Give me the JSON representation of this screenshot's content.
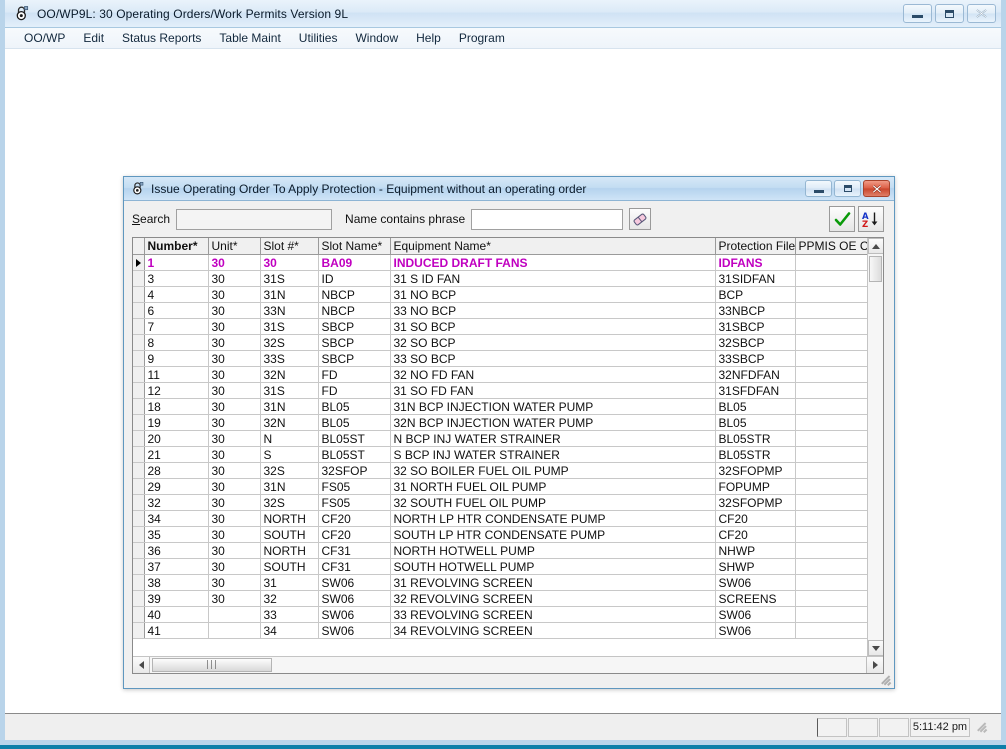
{
  "app": {
    "title": "OO/WP9L: 30  Operating Orders/Work Permits Version 9L",
    "icon": "padlock-icon",
    "window_buttons": {
      "minimize": "minimize-icon",
      "maximize": "maximize-icon",
      "close": "close-icon"
    }
  },
  "menubar": {
    "items": [
      {
        "label": "OO/WP"
      },
      {
        "label": "Edit"
      },
      {
        "label": "Status Reports"
      },
      {
        "label": "Table Maint"
      },
      {
        "label": "Utilities"
      },
      {
        "label": "Window"
      },
      {
        "label": "Help"
      },
      {
        "label": "Program"
      }
    ]
  },
  "child_window": {
    "title": "Issue Operating Order To Apply Protection - Equipment without an operating order",
    "icon": "padlock-icon",
    "window_buttons": {
      "minimize": "minimize-icon",
      "restore": "restore-icon",
      "close": "close-icon"
    },
    "toolbar": {
      "search_label": "Search",
      "search_label_mnemonic": "S",
      "search_value": "",
      "search_placeholder": "",
      "phrase_label": "Name contains phrase",
      "phrase_value": "",
      "phrase_placeholder": "",
      "eraser_button": "eraser-icon",
      "accept_button": "green-check-icon",
      "sort_button": "sort-az-icon"
    }
  },
  "grid": {
    "columns": [
      {
        "key": "number",
        "label": "Number*"
      },
      {
        "key": "unit",
        "label": "Unit*"
      },
      {
        "key": "slot_num",
        "label": "Slot #*"
      },
      {
        "key": "slot_name",
        "label": "Slot Name*"
      },
      {
        "key": "equipment_name",
        "label": "Equipment Name*"
      },
      {
        "key": "protection_file",
        "label": "Protection File*"
      },
      {
        "key": "ppmis_oe_code",
        "label": "PPMIS OE Code*"
      }
    ],
    "selected_row_index": 0,
    "rows": [
      {
        "number": "1",
        "unit": "30",
        "slot_num": "30",
        "slot_name": "BA09",
        "equipment_name": "INDUCED DRAFT FANS",
        "protection_file": "IDFANS",
        "ppmis_oe_code": ""
      },
      {
        "number": "3",
        "unit": "30",
        "slot_num": "31S",
        "slot_name": "ID",
        "equipment_name": "31 S ID FAN",
        "protection_file": "31SIDFAN",
        "ppmis_oe_code": ""
      },
      {
        "number": "4",
        "unit": "30",
        "slot_num": "31N",
        "slot_name": "NBCP",
        "equipment_name": "31 NO BCP",
        "protection_file": "BCP",
        "ppmis_oe_code": ""
      },
      {
        "number": "6",
        "unit": "30",
        "slot_num": "33N",
        "slot_name": "NBCP",
        "equipment_name": "33 NO BCP",
        "protection_file": "33NBCP",
        "ppmis_oe_code": ""
      },
      {
        "number": "7",
        "unit": "30",
        "slot_num": "31S",
        "slot_name": "SBCP",
        "equipment_name": "31 SO BCP",
        "protection_file": "31SBCP",
        "ppmis_oe_code": ""
      },
      {
        "number": "8",
        "unit": "30",
        "slot_num": "32S",
        "slot_name": "SBCP",
        "equipment_name": "32 SO BCP",
        "protection_file": "32SBCP",
        "ppmis_oe_code": ""
      },
      {
        "number": "9",
        "unit": "30",
        "slot_num": "33S",
        "slot_name": "SBCP",
        "equipment_name": "33 SO BCP",
        "protection_file": "33SBCP",
        "ppmis_oe_code": ""
      },
      {
        "number": "11",
        "unit": "30",
        "slot_num": "32N",
        "slot_name": "FD",
        "equipment_name": "32 NO FD FAN",
        "protection_file": "32NFDFAN",
        "ppmis_oe_code": ""
      },
      {
        "number": "12",
        "unit": "30",
        "slot_num": "31S",
        "slot_name": "FD",
        "equipment_name": "31 SO FD FAN",
        "protection_file": "31SFDFAN",
        "ppmis_oe_code": ""
      },
      {
        "number": "18",
        "unit": "30",
        "slot_num": "31N",
        "slot_name": "BL05",
        "equipment_name": "31N BCP INJECTION WATER PUMP",
        "protection_file": "BL05",
        "ppmis_oe_code": ""
      },
      {
        "number": "19",
        "unit": "30",
        "slot_num": "32N",
        "slot_name": "BL05",
        "equipment_name": "32N BCP INJECTION WATER PUMP",
        "protection_file": "BL05",
        "ppmis_oe_code": ""
      },
      {
        "number": "20",
        "unit": "30",
        "slot_num": "N",
        "slot_name": "BL05ST",
        "equipment_name": "N BCP INJ WATER STRAINER",
        "protection_file": "BL05STR",
        "ppmis_oe_code": ""
      },
      {
        "number": "21",
        "unit": "30",
        "slot_num": "S",
        "slot_name": "BL05ST",
        "equipment_name": "S BCP INJ WATER STRAINER",
        "protection_file": "BL05STR",
        "ppmis_oe_code": ""
      },
      {
        "number": "28",
        "unit": "30",
        "slot_num": "32S",
        "slot_name": "32SFOP",
        "equipment_name": "32 SO BOILER FUEL OIL PUMP",
        "protection_file": "32SFOPMP",
        "ppmis_oe_code": ""
      },
      {
        "number": "29",
        "unit": "30",
        "slot_num": "31N",
        "slot_name": "FS05",
        "equipment_name": "31 NORTH FUEL OIL PUMP",
        "protection_file": "FOPUMP",
        "ppmis_oe_code": ""
      },
      {
        "number": "32",
        "unit": "30",
        "slot_num": "32S",
        "slot_name": "FS05",
        "equipment_name": "32 SOUTH FUEL OIL PUMP",
        "protection_file": "32SFOPMP",
        "ppmis_oe_code": ""
      },
      {
        "number": "34",
        "unit": "30",
        "slot_num": "NORTH",
        "slot_name": "CF20",
        "equipment_name": "NORTH LP HTR CONDENSATE PUMP",
        "protection_file": "CF20",
        "ppmis_oe_code": ""
      },
      {
        "number": "35",
        "unit": "30",
        "slot_num": "SOUTH",
        "slot_name": "CF20",
        "equipment_name": "SOUTH LP HTR CONDENSATE PUMP",
        "protection_file": "CF20",
        "ppmis_oe_code": ""
      },
      {
        "number": "36",
        "unit": "30",
        "slot_num": "NORTH",
        "slot_name": "CF31",
        "equipment_name": "NORTH HOTWELL PUMP",
        "protection_file": "NHWP",
        "ppmis_oe_code": ""
      },
      {
        "number": "37",
        "unit": "30",
        "slot_num": "SOUTH",
        "slot_name": "CF31",
        "equipment_name": "SOUTH HOTWELL PUMP",
        "protection_file": "SHWP",
        "ppmis_oe_code": ""
      },
      {
        "number": "38",
        "unit": "30",
        "slot_num": "31",
        "slot_name": "SW06",
        "equipment_name": "31 REVOLVING SCREEN",
        "protection_file": "SW06",
        "ppmis_oe_code": ""
      },
      {
        "number": "39",
        "unit": "30",
        "slot_num": "32",
        "slot_name": "SW06",
        "equipment_name": "32 REVOLVING SCREEN",
        "protection_file": "SCREENS",
        "ppmis_oe_code": ""
      },
      {
        "number": "40",
        "unit": "",
        "slot_num": "33",
        "slot_name": "SW06",
        "equipment_name": "33 REVOLVING SCREEN",
        "protection_file": "SW06",
        "ppmis_oe_code": ""
      },
      {
        "number": "41",
        "unit": "",
        "slot_num": "34",
        "slot_name": "SW06",
        "equipment_name": "34 REVOLVING SCREEN",
        "protection_file": "SW06",
        "ppmis_oe_code": ""
      }
    ]
  },
  "statusbar": {
    "panel1": "",
    "panel2": "",
    "panel3": "",
    "clock": "5:11:42 pm"
  },
  "colors": {
    "selected_row": "#c000c0",
    "accent_title": "#b5d3ee",
    "desktop": "#0d7ea8"
  }
}
